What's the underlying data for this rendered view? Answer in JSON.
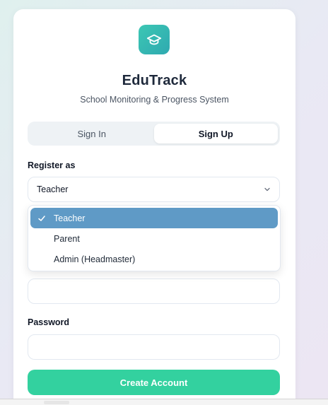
{
  "app": {
    "title": "EduTrack",
    "subtitle": "School Monitoring & Progress System",
    "logo_icon": "graduation-cap-icon"
  },
  "tabs": [
    {
      "label": "Sign In",
      "active": false
    },
    {
      "label": "Sign Up",
      "active": true
    }
  ],
  "form": {
    "role_label": "Register as",
    "role_value": "Teacher",
    "role_options": [
      {
        "label": "Teacher",
        "selected": true
      },
      {
        "label": "Parent",
        "selected": false
      },
      {
        "label": "Admin (Headmaster)",
        "selected": false
      }
    ],
    "email_value": "",
    "password_label": "Password",
    "password_value": "",
    "submit_label": "Create Account"
  },
  "colors": {
    "accent": "#33d19f",
    "logo_start": "#3cc7b4",
    "logo_end": "#2fa9b0",
    "selected_option": "#5f9ac6"
  }
}
